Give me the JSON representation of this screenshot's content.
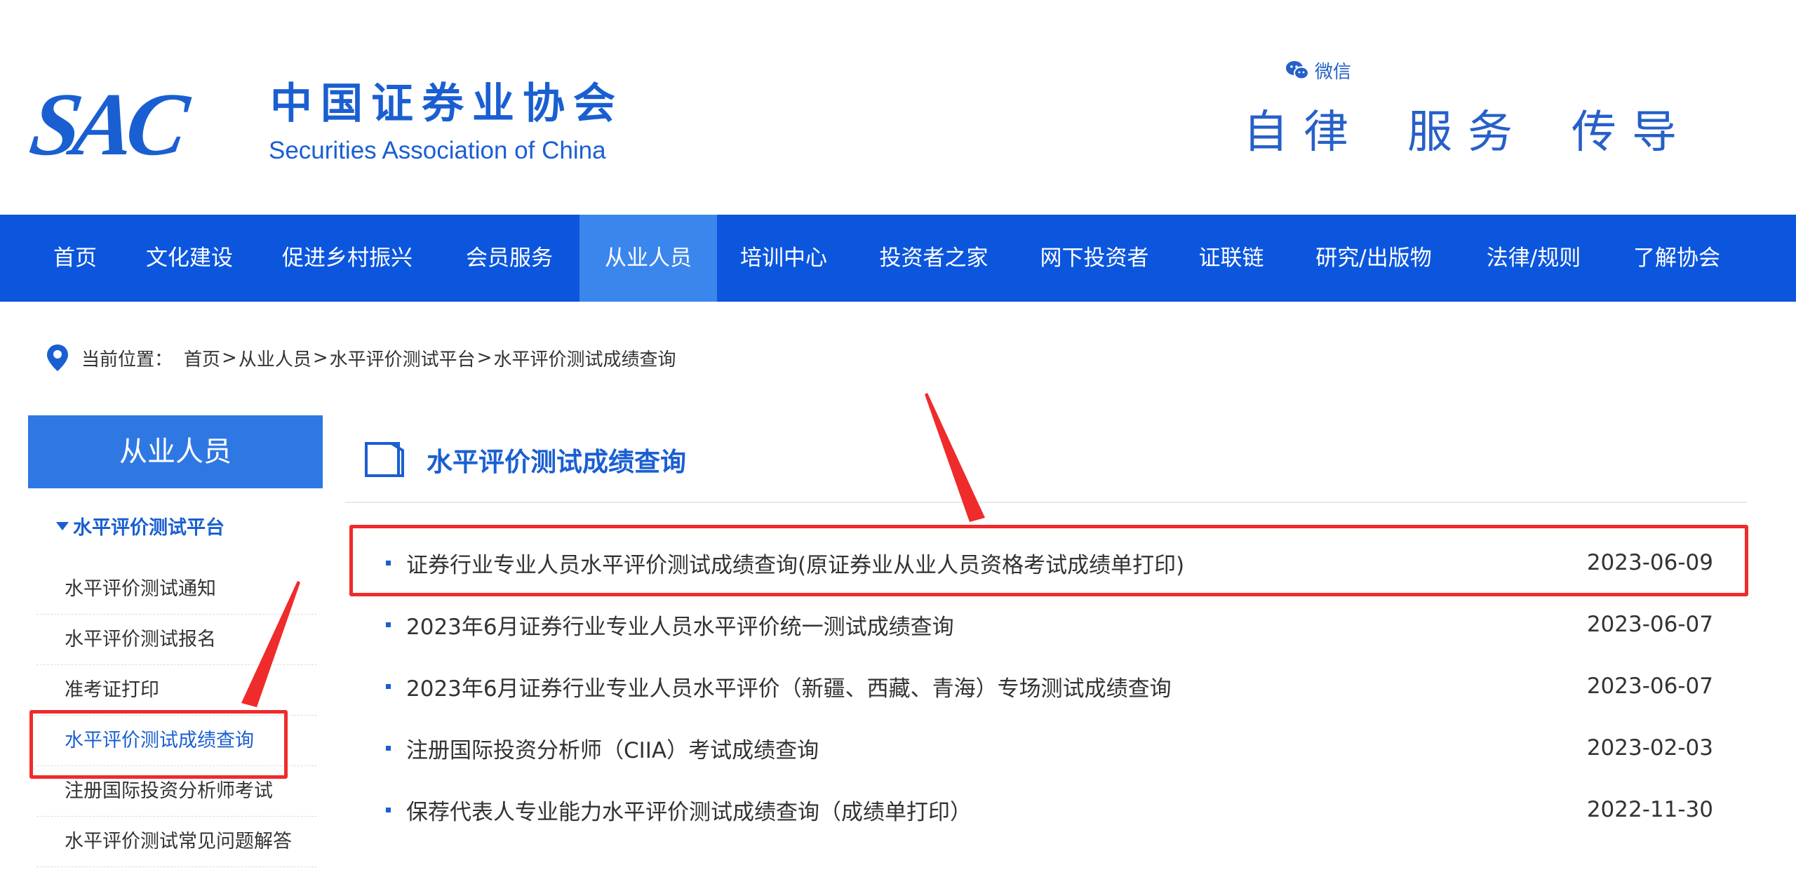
{
  "header": {
    "logo_mark": "SAC",
    "logo_cn": "中国证券业协会",
    "logo_en": "Securities Association of China",
    "wechat_label": "微信",
    "slogan": [
      "自律",
      "服务",
      "传导"
    ]
  },
  "nav": {
    "items": [
      {
        "label": "首页"
      },
      {
        "label": "文化建设"
      },
      {
        "label": "促进乡村振兴"
      },
      {
        "label": "会员服务"
      },
      {
        "label": "从业人员"
      },
      {
        "label": "培训中心"
      },
      {
        "label": "投资者之家"
      },
      {
        "label": "网下投资者"
      },
      {
        "label": "证联链"
      },
      {
        "label": "研究/出版物"
      },
      {
        "label": "法律/规则"
      },
      {
        "label": "了解协会"
      }
    ],
    "active_index": 4
  },
  "breadcrumb": {
    "label": "当前位置：",
    "items": [
      "首页",
      "从业人员",
      "水平评价测试平台",
      "水平评价测试成绩查询"
    ],
    "separator": ">"
  },
  "sidebar": {
    "title": "从业人员",
    "group_title": "水平评价测试平台",
    "items": [
      {
        "label": "水平评价测试通知"
      },
      {
        "label": "水平评价测试报名"
      },
      {
        "label": "准考证打印"
      },
      {
        "label": "水平评价测试成绩查询"
      },
      {
        "label": "注册国际投资分析师考试"
      },
      {
        "label": "水平评价测试常见问题解答"
      }
    ],
    "active_index": 3
  },
  "main": {
    "title": "水平评价测试成绩查询",
    "list": [
      {
        "title": "证券行业专业人员水平评价测试成绩查询(原证券业从业人员资格考试成绩单打印)",
        "date": "2023-06-09"
      },
      {
        "title": "2023年6月证券行业专业人员水平评价统一测试成绩查询",
        "date": "2023-06-07"
      },
      {
        "title": "2023年6月证券行业专业人员水平评价（新疆、西藏、青海）专场测试成绩查询",
        "date": "2023-06-07"
      },
      {
        "title": "注册国际投资分析师（CIIA）考试成绩查询",
        "date": "2023-02-03"
      },
      {
        "title": "保荐代表人专业能力水平评价测试成绩查询（成绩单打印）",
        "date": "2022-11-30"
      }
    ]
  },
  "colors": {
    "brand": "#1a5fd1",
    "nav_bg": "#0c56de",
    "nav_active": "#3b86ec",
    "annotation": "#ef2b2b"
  }
}
